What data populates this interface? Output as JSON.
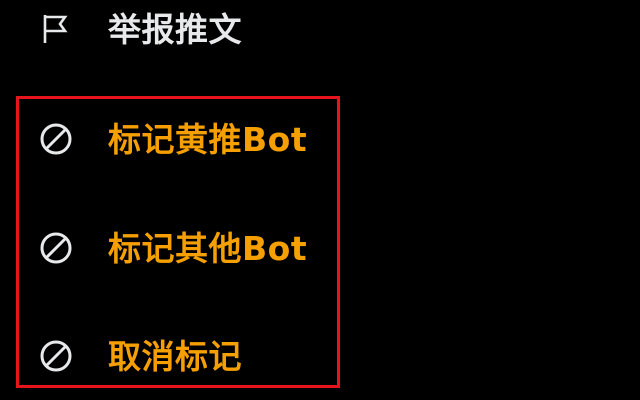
{
  "menu": {
    "items": [
      {
        "label": "举报推文",
        "icon": "flag-icon"
      },
      {
        "label": "标记黄推Bot",
        "icon": "block-icon"
      },
      {
        "label": "标记其他Bot",
        "icon": "block-icon"
      },
      {
        "label": "取消标记",
        "icon": "block-icon"
      }
    ]
  },
  "colors": {
    "background": "#000000",
    "text": "#e7e9ea",
    "accent": "#f5a000",
    "highlight_border": "#e8141c",
    "icon": "#e7e9ea"
  }
}
